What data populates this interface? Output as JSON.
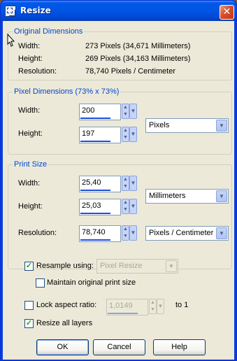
{
  "window": {
    "title": "Resize",
    "close_glyph": "✕"
  },
  "original": {
    "title": "Original Dimensions",
    "width_label": "Width:",
    "width_value": "273 Pixels (34,671 Millimeters)",
    "height_label": "Height:",
    "height_value": "269 Pixels (34,163 Millimeters)",
    "resolution_label": "Resolution:",
    "resolution_value": "78,740 Pixels / Centimeter"
  },
  "pixel": {
    "title": "Pixel Dimensions (73% x 73%)",
    "width_label": "Width:",
    "width_value": "200",
    "height_label": "Height:",
    "height_value": "197",
    "unit": "Pixels"
  },
  "print": {
    "title": "Print Size",
    "width_label": "Width:",
    "width_value": "25,40",
    "height_label": "Height:",
    "height_value": "25,03",
    "unit": "Millimeters",
    "resolution_label": "Resolution:",
    "resolution_value": "78,740",
    "resolution_unit": "Pixels / Centimeter"
  },
  "options": {
    "resample_label": "Resample using:",
    "resample_checked": true,
    "resample_method": "Pixel Resize",
    "maintain_label": "Maintain original print size",
    "maintain_checked": false,
    "lock_label": "Lock aspect ratio:",
    "lock_checked": false,
    "lock_value": "1,0149",
    "lock_suffix": "to 1",
    "resize_layers_label": "Resize all layers",
    "resize_layers_checked": true
  },
  "buttons": {
    "ok": "OK",
    "cancel": "Cancel",
    "help": "Help"
  },
  "icons": {
    "check": "✓",
    "spin_up_down": "▲▼",
    "dropdown": "▼"
  },
  "colors": {
    "title_bar": "#0055e5",
    "group_title": "#0046d5",
    "dialog_bg": "#ece9d8",
    "close": "#d6502c",
    "check": "#21a121"
  }
}
